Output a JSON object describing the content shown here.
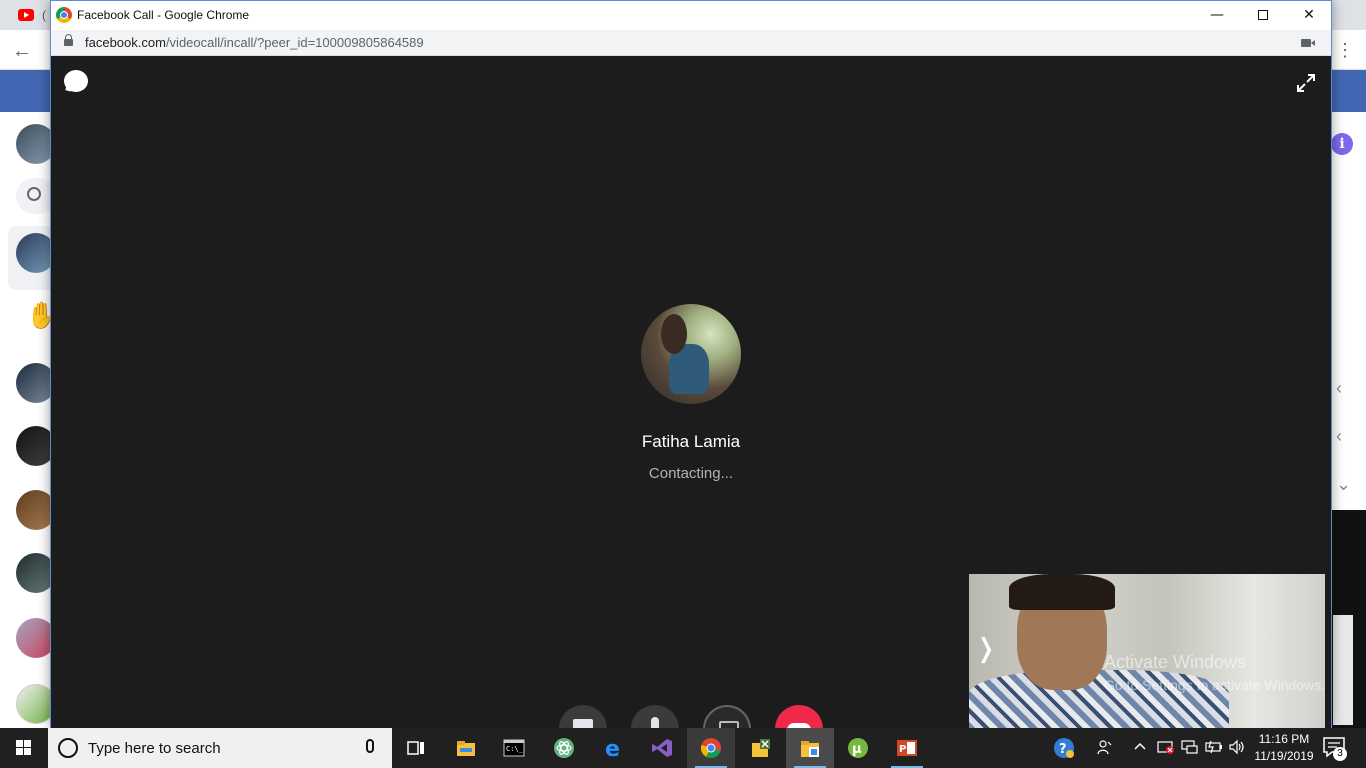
{
  "background_browser": {
    "tab_title_fragment": "(",
    "right_info_icon": "i"
  },
  "popup": {
    "window_title": "Facebook Call - Google Chrome",
    "url_host": "facebook.com",
    "url_path": "/videocall/incall/?peer_id=100009805864589",
    "window_controls": {
      "minimize": "—",
      "close": "✕"
    }
  },
  "call": {
    "contact_name": "Fatiha Lamia",
    "status": "Contacting...",
    "controls": [
      "video-toggle",
      "mic-toggle",
      "screen-share",
      "end-call"
    ],
    "self_view_toggle": "❭",
    "watermark": {
      "title": "Activate Windows",
      "subtitle": "Go to Settings to activate Windows."
    }
  },
  "taskbar": {
    "search_placeholder": "Type here to search",
    "apps": [
      "task-view",
      "file-explorer",
      "terminal",
      "atom",
      "edge",
      "visual-studio",
      "chrome",
      "app-1",
      "app-2",
      "utorrent",
      "powerpoint"
    ],
    "time": "11:16 PM",
    "date": "11/19/2019",
    "notification_count": "3"
  },
  "colors": {
    "facebook_blue": "#4267b2",
    "call_background": "#1c1c1c",
    "end_call_red": "#f02849",
    "taskbar": "#202020"
  }
}
